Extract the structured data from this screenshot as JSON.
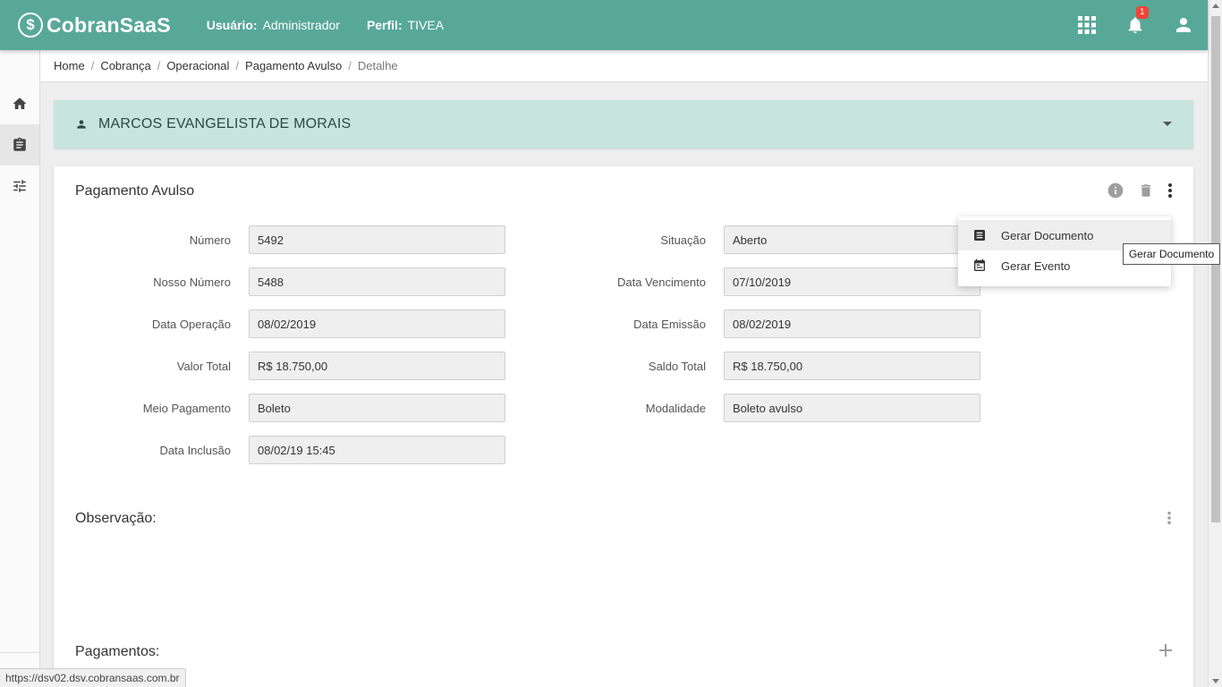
{
  "header": {
    "brand": "CobranSaaS",
    "user_label": "Usuário:",
    "user_value": "Administrador",
    "profile_label": "Perfil:",
    "profile_value": "TIVEA",
    "notification_count": "1"
  },
  "breadcrumb": [
    "Home",
    "Cobrança",
    "Operacional",
    "Pagamento Avulso",
    "Detalhe"
  ],
  "client": {
    "name": "MARCOS EVANGELISTA DE MORAIS"
  },
  "card": {
    "title": "Pagamento Avulso",
    "fields_left": [
      {
        "label": "Número",
        "value": "5492"
      },
      {
        "label": "Nosso Número",
        "value": "5488"
      },
      {
        "label": "Data Operação",
        "value": "08/02/2019"
      },
      {
        "label": "Valor Total",
        "value": "R$ 18.750,00"
      },
      {
        "label": "Meio Pagamento",
        "value": "Boleto"
      },
      {
        "label": "Data Inclusão",
        "value": "08/02/19 15:45"
      }
    ],
    "fields_right": [
      {
        "label": "Situação",
        "value": "Aberto"
      },
      {
        "label": "Data Vencimento",
        "value": "07/10/2019"
      },
      {
        "label": "Data Emissão",
        "value": "08/02/2019"
      },
      {
        "label": "Saldo Total",
        "value": "R$ 18.750,00"
      },
      {
        "label": "Modalidade",
        "value": "Boleto avulso"
      }
    ],
    "observacao_title": "Observação:",
    "pagamentos_title": "Pagamentos:"
  },
  "menu": {
    "items": [
      {
        "label": "Gerar Documento",
        "icon": "document-icon"
      },
      {
        "label": "Gerar Evento",
        "icon": "event-icon"
      }
    ]
  },
  "tooltip": "Gerar Documento",
  "status_url": "https://dsv02.dsv.cobransaas.com.br",
  "colors": {
    "primary": "#58a899",
    "banner": "#c7e4dd",
    "badge": "#f44336"
  }
}
